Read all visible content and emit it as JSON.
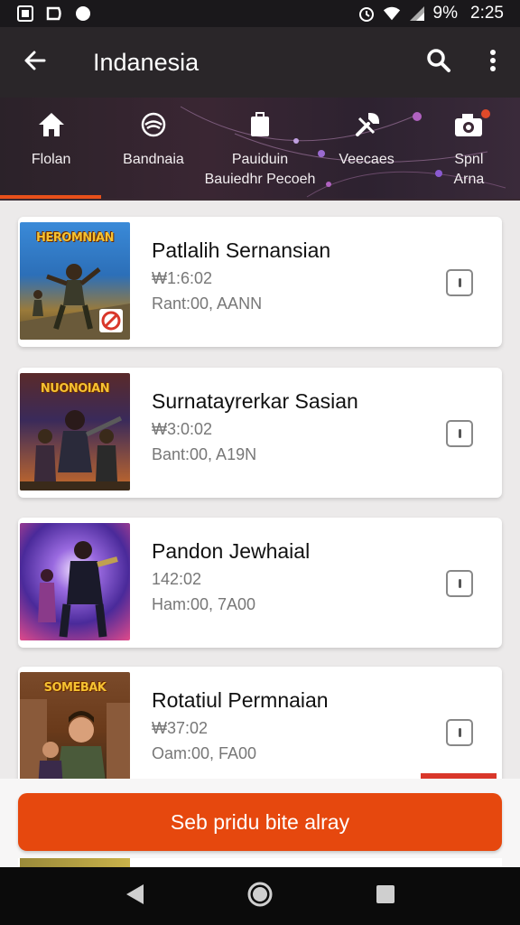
{
  "status_bar": {
    "battery_text": "9%",
    "time": "2:25",
    "icons": [
      "notification-icon",
      "app-icon",
      "circle-icon",
      "alarm-icon",
      "wifi-icon",
      "signal-icon"
    ]
  },
  "app_bar": {
    "title": "Indanesia",
    "back_icon": "arrow-left-icon",
    "search_icon": "search-icon",
    "more_icon": "more-vertical-icon"
  },
  "tabs": [
    {
      "label": "Flolan",
      "sub": "",
      "icon": "home-icon",
      "selected": true
    },
    {
      "label": "Bandnaia",
      "sub": "",
      "icon": "controller-icon",
      "selected": false
    },
    {
      "label": "Pauiduin",
      "sub": "Bauiedhr Pecoeh",
      "icon": "bag-icon",
      "selected": false
    },
    {
      "label": "Veecaes",
      "sub": "",
      "icon": "tools-icon",
      "selected": false
    },
    {
      "label": "Spnl",
      "sub": "Arna",
      "icon": "camera-icon",
      "selected": false
    }
  ],
  "games": [
    {
      "thumb_title": "HEROMNIAN",
      "title": "Patlalih Sernansian",
      "line1": "₩1:6:02",
      "line2": "Rant:00, AANN",
      "colors": [
        "#2c6fb8",
        "#d9a441"
      ]
    },
    {
      "thumb_title": "NUONOIAN",
      "title": "Surnatayrerkar Sasian",
      "line1": "₩3:0:02",
      "line2": "Bant:00, A19N",
      "colors": [
        "#3a2a5a",
        "#c66a2a"
      ]
    },
    {
      "thumb_title": "",
      "title": "Pandon Jewhaial",
      "line1": "142:02",
      "line2": "Ham:00, 7A00",
      "colors": [
        "#4a2a9a",
        "#e04a8a"
      ]
    },
    {
      "thumb_title": "SOMEBAK",
      "title": "Rotatiul Permnaian",
      "line1": "₩37:02",
      "line2": "Oam:00, FA00",
      "colors": [
        "#6a3a1a",
        "#b8863a"
      ]
    }
  ],
  "cta": {
    "label": "Seb pridu bite alray"
  },
  "nav": {
    "back": "nav-back-icon",
    "home": "nav-home-icon",
    "recents": "nav-recents-icon"
  },
  "colors": {
    "accent": "#e6480e",
    "appbar": "#2a2629"
  }
}
